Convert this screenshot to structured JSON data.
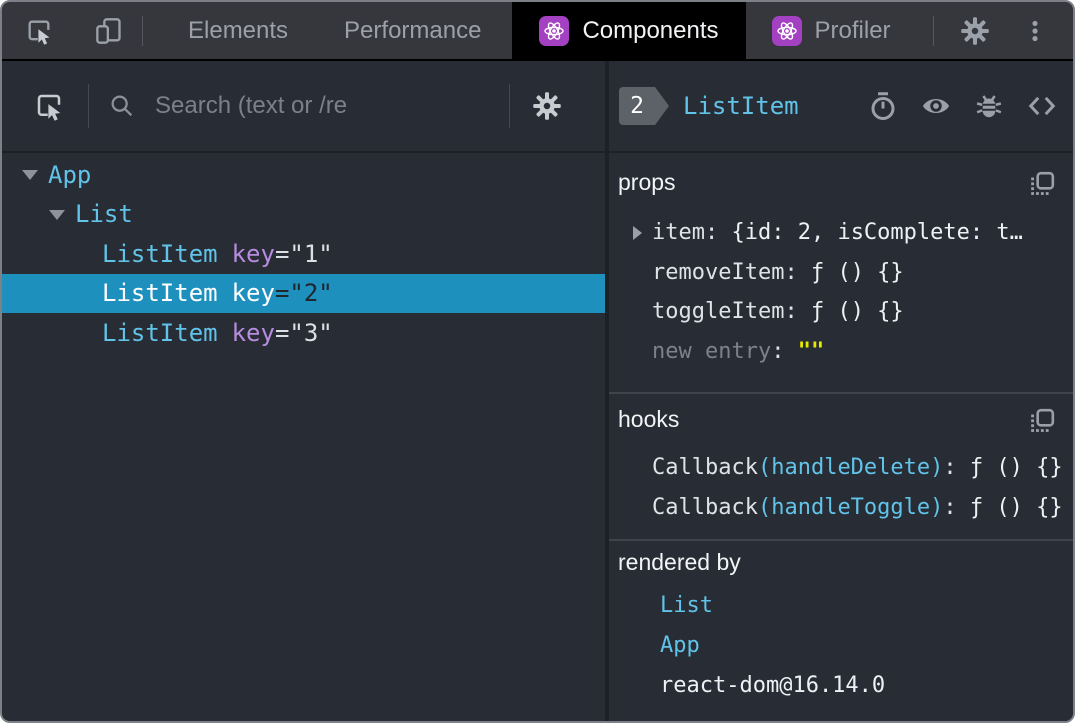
{
  "theme": {
    "panel_bg": "#282c34",
    "topbar_bg": "#35373c",
    "accent_cyan": "#61c3e8",
    "key_purple": "#b88ce0",
    "selected_row_bg": "#1e90bd",
    "editable_yellow": "#e8e800",
    "react_icon_purple": "#a440c2"
  },
  "topbar": {
    "tabs": [
      {
        "label": "Elements",
        "active": false
      },
      {
        "label": "Performance",
        "active": false
      },
      {
        "label": "Components",
        "active": true
      },
      {
        "label": "Profiler",
        "active": false
      }
    ]
  },
  "left_panel": {
    "search_placeholder": "Search (text or /re",
    "tree": [
      {
        "name": "App",
        "depth": 0,
        "expanded": true
      },
      {
        "name": "List",
        "depth": 1,
        "expanded": true
      },
      {
        "name": "ListItem",
        "attr_name": "key",
        "attr_rest": "=\"1\"",
        "depth": 2,
        "selected": false
      },
      {
        "name": "ListItem",
        "attr_name": "key",
        "attr_rest": "=\"2\"",
        "depth": 2,
        "selected": true
      },
      {
        "name": "ListItem",
        "attr_name": "key",
        "attr_rest": "=\"3\"",
        "depth": 2,
        "selected": false
      }
    ]
  },
  "right_panel": {
    "badge_count": "2",
    "component_name": "ListItem",
    "props": {
      "title": "props",
      "rows": [
        {
          "name": "item",
          "sep": ": ",
          "value": "{id: 2, isComplete: t…"
        },
        {
          "name": "removeItem",
          "sep": ": ",
          "value": "ƒ () {}"
        },
        {
          "name": "toggleItem",
          "sep": ": ",
          "value": "ƒ () {}"
        },
        {
          "name": "new entry",
          "sep": ": ",
          "value": "\"\""
        }
      ]
    },
    "hooks": {
      "title": "hooks",
      "rows": [
        {
          "prefix": "Callback",
          "paren": "(handleDelete)",
          "sep": ": ",
          "value": "ƒ () {}"
        },
        {
          "prefix": "Callback",
          "paren": "(handleToggle)",
          "sep": ": ",
          "value": "ƒ () {}"
        }
      ]
    },
    "rendered_by": {
      "title": "rendered by",
      "items": [
        {
          "label": "List"
        },
        {
          "label": "App"
        },
        {
          "label": "react-dom@16.14.0"
        }
      ]
    }
  }
}
